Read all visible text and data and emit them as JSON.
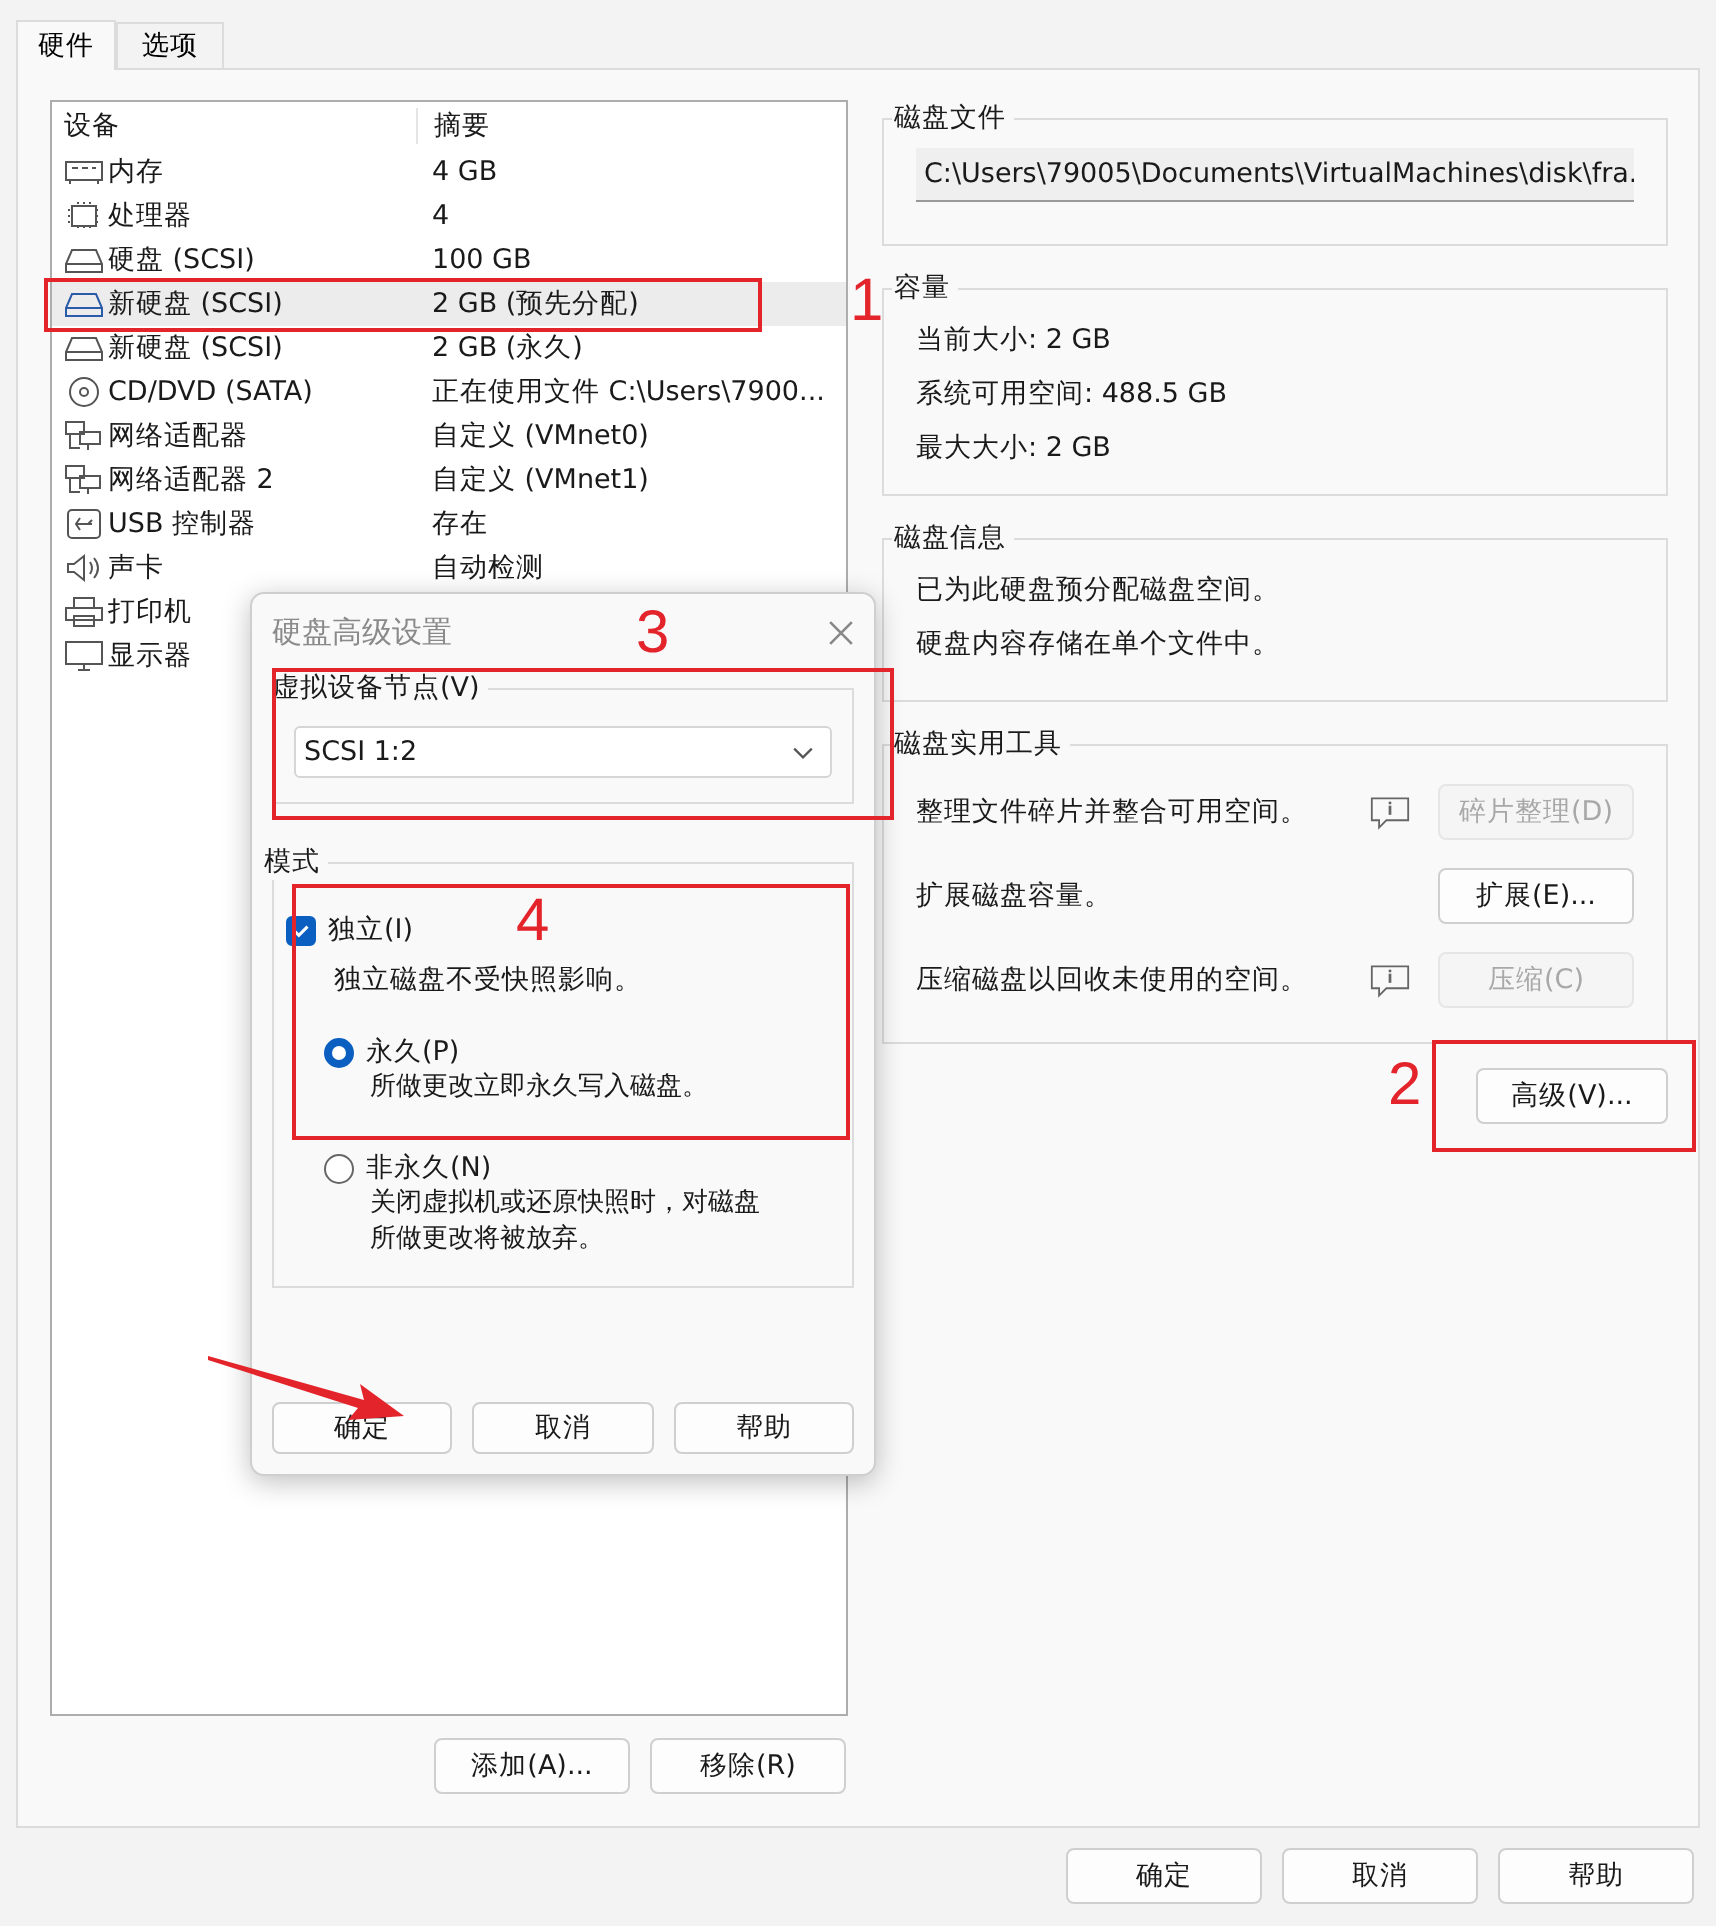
{
  "tabs": [
    {
      "label": "硬件",
      "selected": true
    },
    {
      "label": "选项",
      "selected": false
    }
  ],
  "device_list": {
    "columns": [
      "设备",
      "摘要"
    ],
    "rows": [
      {
        "kind": "memory",
        "device": "内存",
        "summary": "4 GB",
        "selected": false
      },
      {
        "kind": "cpu",
        "device": "处理器",
        "summary": "4",
        "selected": false
      },
      {
        "kind": "disk",
        "device": "硬盘 (SCSI)",
        "summary": "100 GB",
        "selected": false
      },
      {
        "kind": "disk",
        "device": "新硬盘 (SCSI)",
        "summary": "2 GB (预先分配)",
        "selected": true
      },
      {
        "kind": "disk",
        "device": "新硬盘 (SCSI)",
        "summary": "2 GB (永久)",
        "selected": false
      },
      {
        "kind": "cd",
        "device": "CD/DVD (SATA)",
        "summary": "正在使用文件 C:\\Users\\7900...",
        "selected": false
      },
      {
        "kind": "network",
        "device": "网络适配器",
        "summary": "自定义 (VMnet0)",
        "selected": false
      },
      {
        "kind": "network",
        "device": "网络适配器 2",
        "summary": "自定义 (VMnet1)",
        "selected": false
      },
      {
        "kind": "usb",
        "device": "USB 控制器",
        "summary": "存在",
        "selected": false
      },
      {
        "kind": "sound",
        "device": "声卡",
        "summary": "自动检测",
        "selected": false
      },
      {
        "kind": "printer",
        "device": "打印机",
        "selected": false
      },
      {
        "kind": "display",
        "device": "显示器",
        "selected": false
      }
    ]
  },
  "list_buttons": [
    "添加(A)...",
    "移除(R)"
  ],
  "disk_file": {
    "title": "磁盘文件",
    "path": "C:\\Users\\79005\\Documents\\VirtualMachines\\disk\\fra."
  },
  "capacity": {
    "title": "容量",
    "lines": [
      "当前大小: 2 GB",
      "系统可用空间: 488.5 GB",
      "最大大小: 2 GB"
    ]
  },
  "disk_info": {
    "title": "磁盘信息",
    "lines": [
      "已为此硬盘预分配磁盘空间。",
      "硬盘内容存储在单个文件中。"
    ]
  },
  "utilities": {
    "title": "磁盘实用工具",
    "rows": [
      {
        "text": "整理文件碎片并整合可用空间。",
        "info_icon": true,
        "button": "碎片整理(D)",
        "disabled": true
      },
      {
        "text": "扩展磁盘容量。",
        "info_icon": false,
        "button": "扩展(E)...",
        "disabled": false
      },
      {
        "text": "压缩磁盘以回收未使用的空间。",
        "info_icon": true,
        "button": "压缩(C)",
        "disabled": true
      }
    ]
  },
  "advanced_button": "高级(V)...",
  "dialog": {
    "title": "硬盘高级设置",
    "node": {
      "title": "虚拟设备节点(V)",
      "value": "SCSI 1:2"
    },
    "mode": {
      "title": "模式",
      "independent": {
        "label": "独立(I)",
        "checked": true,
        "description": "独立磁盘不受快照影响。"
      },
      "options": [
        {
          "label": "永久(P)",
          "description": "所做更改立即永久写入磁盘。",
          "selected": true
        },
        {
          "label": "非永久(N)",
          "description": "关闭虚拟机或还原快照时，对磁盘所做更改将被放弃。",
          "selected": false
        }
      ]
    },
    "buttons": [
      "确定",
      "取消",
      "帮助"
    ]
  },
  "window_buttons": [
    "确定",
    "取消",
    "帮助"
  ],
  "annotations": [
    {
      "label": "1"
    },
    {
      "label": "2"
    },
    {
      "label": "3"
    },
    {
      "label": "4"
    }
  ]
}
